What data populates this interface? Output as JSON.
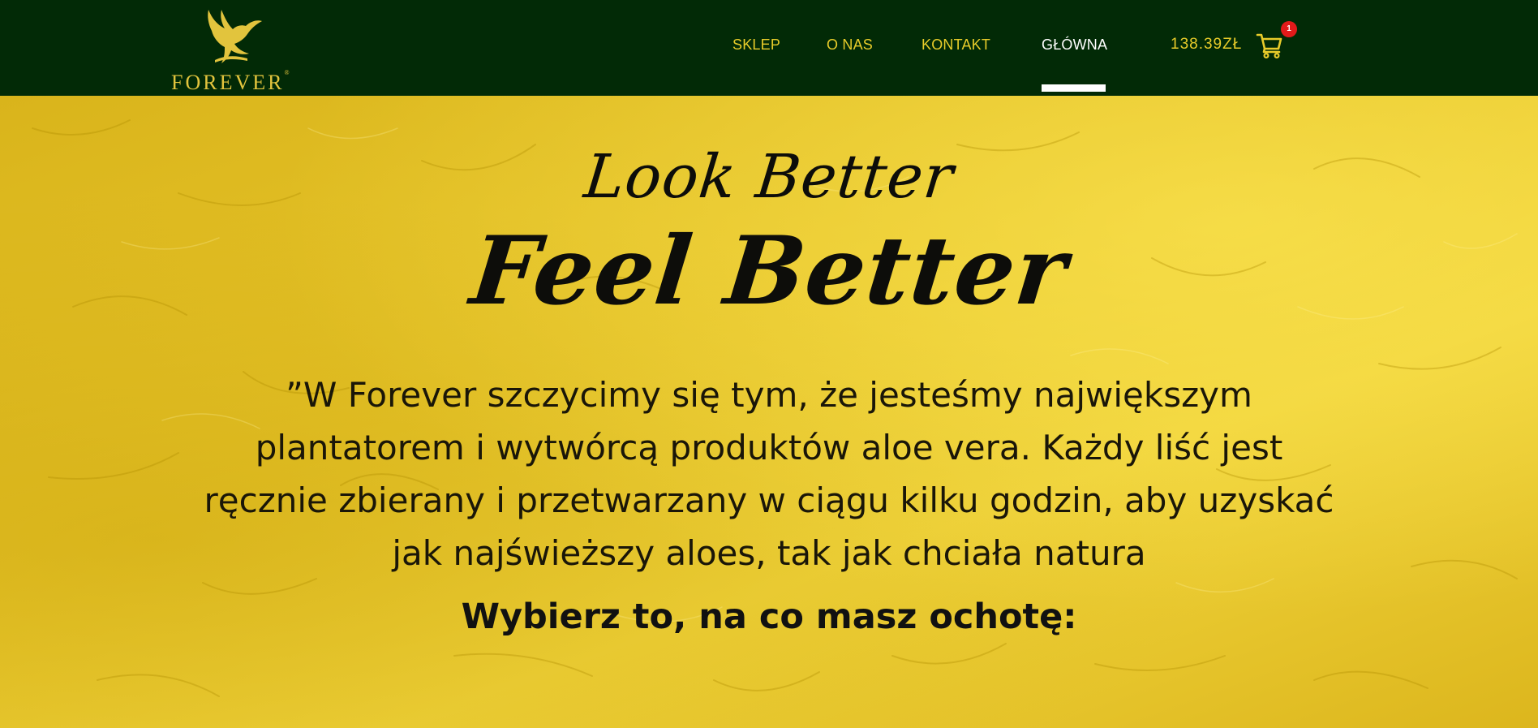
{
  "brand": {
    "name": "FOREVER",
    "registered_mark": "®",
    "icon": "eagle-logo",
    "gold": "#e2c43d",
    "header_background": "#022a06"
  },
  "nav": {
    "items": [
      {
        "label": "SKLEP",
        "active": false
      },
      {
        "label": "O NAS",
        "active": false
      },
      {
        "label": "KONTAKT",
        "active": false
      },
      {
        "label": "GŁÓWNA",
        "active": true
      }
    ],
    "link_color": "#e8cc2a",
    "active_color": "#ffffff"
  },
  "cart": {
    "total": "138.39ZŁ",
    "count": "1",
    "icon": "cart-icon",
    "badge_color": "#e21a1a"
  },
  "hero": {
    "headline_small": "Look Better",
    "headline_large": "Feel Better",
    "quote": "”W Forever szczycimy się tym, że jesteśmy największym plantatorem i wytwórcą produktów aloe vera. Każdy liść jest ręcznie zbierany i przetwarzany w ciągu kilku godzin, aby uzyskać jak najświeższy aloes, tak jak chciała natura",
    "call_to_action": "Wybierz to, na co masz ochotę:",
    "background_color": "#e7c52a"
  }
}
